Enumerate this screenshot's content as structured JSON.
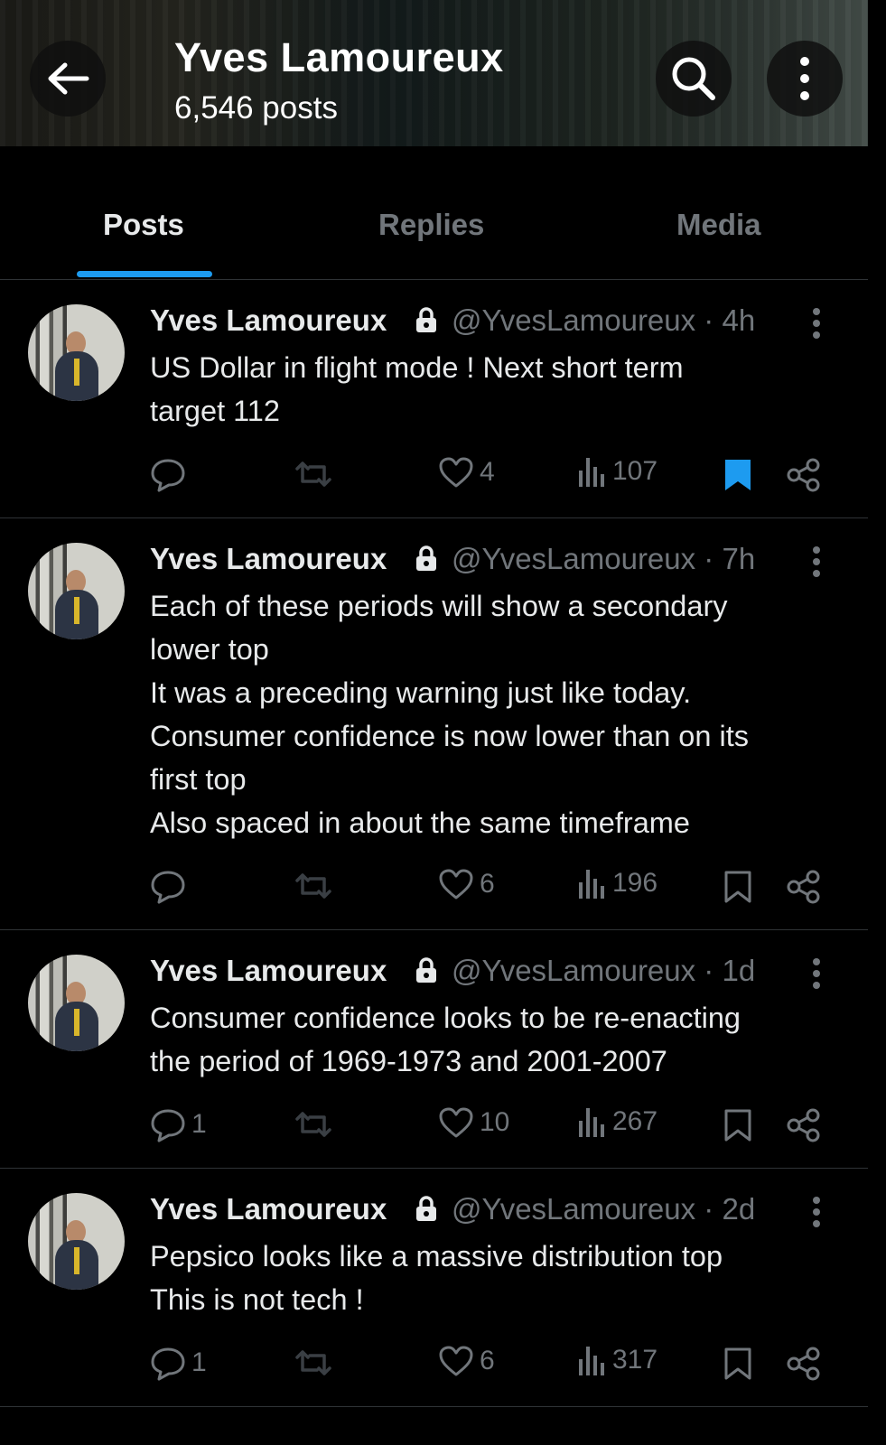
{
  "header": {
    "title": "Yves Lamoureux",
    "subtitle": "6,546 posts"
  },
  "tabs": [
    {
      "label": "Posts",
      "active": true
    },
    {
      "label": "Replies",
      "active": false
    },
    {
      "label": "Media",
      "active": false
    }
  ],
  "colors": {
    "accent": "#1d9bf0",
    "muted": "#71767b",
    "text": "#e7e9ea"
  },
  "posts": [
    {
      "name": "Yves Lamoureux",
      "handle_time": "@YvesLamoureux · 4h",
      "text": "US Dollar in flight mode ! Next short term\ntarget 112",
      "replies": "",
      "likes": "4",
      "views": "107",
      "bookmarked": true
    },
    {
      "name": "Yves Lamoureux",
      "handle_time": "@YvesLamoureux · 7h",
      "text": "Each of these periods will show a secondary\nlower top\nIt was a preceding warning just like today.\nConsumer confidence is now lower than on its\nfirst top\nAlso spaced in about the same timeframe",
      "replies": "",
      "likes": "6",
      "views": "196",
      "bookmarked": false
    },
    {
      "name": "Yves Lamoureux",
      "handle_time": "@YvesLamoureux · 1d",
      "text": "Consumer confidence looks to be re-enacting\nthe period of 1969-1973 and 2001-2007",
      "replies": "1",
      "likes": "10",
      "views": "267",
      "bookmarked": false
    },
    {
      "name": "Yves Lamoureux",
      "handle_time": "@YvesLamoureux · 2d",
      "text": "Pepsico looks like a massive distribution top\nThis is not tech !",
      "replies": "1",
      "likes": "6",
      "views": "317",
      "bookmarked": false
    }
  ]
}
